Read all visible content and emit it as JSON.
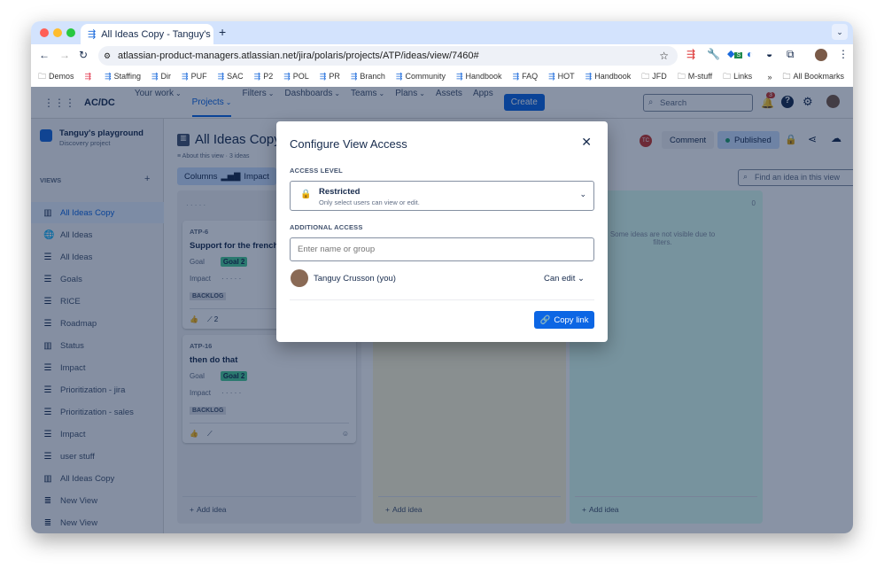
{
  "browser": {
    "tab_title": "All Ideas Copy - Tanguy's pla",
    "url": "atlassian-product-managers.atlassian.net/jira/polaris/projects/ATP/ideas/view/7460#",
    "bookmarks": [
      "Demos",
      "",
      "Staffing",
      "Dir",
      "PUF",
      "SAC",
      "P2",
      "POL",
      "PR",
      "Branch",
      "Community",
      "Handbook",
      "FAQ",
      "HOT",
      "Handbook",
      "JFD",
      "M-stuff",
      "Links"
    ],
    "all_bookmarks": "All Bookmarks",
    "extension_badge": "S"
  },
  "nav": {
    "logo": "AC/DC",
    "items": [
      "Your work",
      "Projects",
      "Filters",
      "Dashboards",
      "Teams",
      "Plans",
      "Assets",
      "Apps"
    ],
    "active": "Projects",
    "create": "Create",
    "search_placeholder": "Search",
    "notification_count": "3"
  },
  "sidebar": {
    "project_name": "Tanguy's playground",
    "project_type": "Discovery project",
    "views_label": "VIEWS",
    "items": [
      {
        "label": "All Ideas Copy",
        "icon": "board"
      },
      {
        "label": "All Ideas",
        "icon": "globe"
      },
      {
        "label": "All Ideas",
        "icon": "list"
      },
      {
        "label": "Goals",
        "icon": "list"
      },
      {
        "label": "RICE",
        "icon": "list"
      },
      {
        "label": "Roadmap",
        "icon": "list"
      },
      {
        "label": "Status",
        "icon": "board"
      },
      {
        "label": "Impact",
        "icon": "list"
      },
      {
        "label": "Prioritization - jira",
        "icon": "list"
      },
      {
        "label": "Prioritization - sales",
        "icon": "list"
      },
      {
        "label": "Impact",
        "icon": "list"
      },
      {
        "label": "user stuff",
        "icon": "list"
      },
      {
        "label": "All Ideas Copy",
        "icon": "board"
      },
      {
        "label": "New View",
        "icon": "timeline"
      },
      {
        "label": "New View",
        "icon": "timeline"
      }
    ]
  },
  "view": {
    "title": "All Ideas Copy",
    "about": "About this view · 3 ideas",
    "columns_btn": "Columns",
    "columns_field": "Impact",
    "avatar_initials": "TC",
    "comment": "Comment",
    "published": "Published",
    "find_placeholder": "Find an idea in this view",
    "columns": [
      {
        "color": "#f1f2f4",
        "count": "",
        "add": "Add idea"
      },
      {
        "color": "#fff7d6",
        "count": "",
        "add": "Add idea"
      },
      {
        "color": "#dcfff1",
        "count": "0",
        "add": "Add idea",
        "empty": "Some ideas are not visible due to filters."
      }
    ],
    "cards": [
      {
        "key": "ATP-6",
        "title": "Support for the french",
        "goal_label": "Goal",
        "goal": "Goal 2",
        "impact_label": "Impact",
        "status": "BACKLOG",
        "insights": "2"
      },
      {
        "key": "ATP-16",
        "title": "then do that",
        "goal_label": "Goal",
        "goal": "Goal 2",
        "impact_label": "Impact",
        "status": "BACKLOG",
        "insights": ""
      }
    ]
  },
  "modal": {
    "title": "Configure View Access",
    "access_level_label": "ACCESS LEVEL",
    "access_level": "Restricted",
    "access_desc": "Only select users can view or edit.",
    "additional_label": "ADDITIONAL ACCESS",
    "input_placeholder": "Enter name or group",
    "user_name": "Tanguy Crusson (you)",
    "permission": "Can edit",
    "copy_link": "Copy link"
  }
}
